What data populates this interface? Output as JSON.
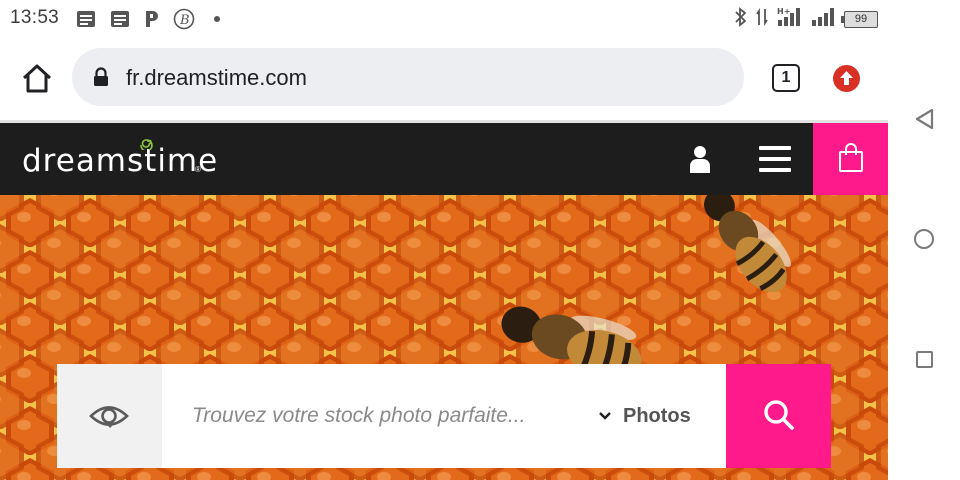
{
  "status_bar": {
    "time": "13:53",
    "notification_icons": [
      "message-icon",
      "message-icon",
      "p-icon",
      "bitcoin-icon",
      "dot-icon"
    ],
    "right_icons": [
      "bluetooth-icon",
      "data-transfer-icon",
      "signal-h-plus-icon",
      "signal-icon"
    ],
    "battery": "99"
  },
  "browser": {
    "url": "fr.dreamstime.com",
    "tab_count": "1",
    "accent_update": "#d93025"
  },
  "site": {
    "logo_text": "dreamstime",
    "brand_color": "#ff1a8c",
    "header_color": "#1d1d1d",
    "logo_accent": "#8bc53f"
  },
  "search": {
    "placeholder": "Trouvez votre stock photo parfaite...",
    "value": "",
    "type_selected": "Photos"
  },
  "android_nav": [
    "back-icon",
    "home-icon",
    "recent-apps-icon"
  ]
}
